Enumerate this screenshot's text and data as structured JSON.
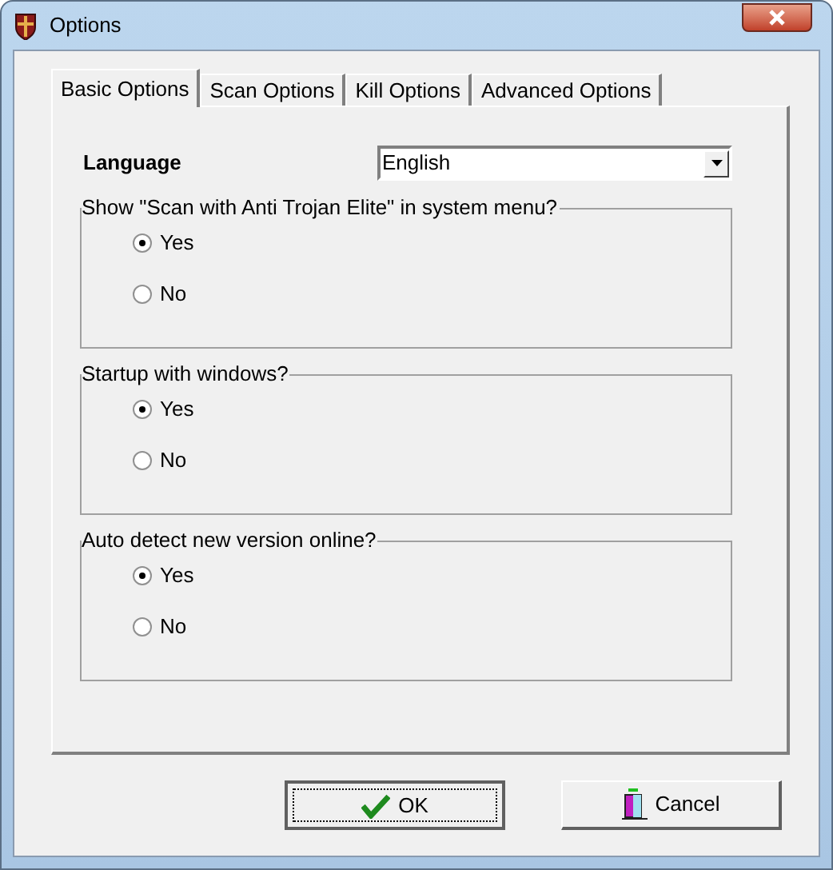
{
  "window": {
    "title": "Options"
  },
  "tabs": [
    {
      "label": "Basic Options",
      "selected": true
    },
    {
      "label": "Scan Options",
      "selected": false
    },
    {
      "label": "Kill Options",
      "selected": false
    },
    {
      "label": "Advanced Options",
      "selected": false
    }
  ],
  "language": {
    "label": "Language",
    "value": "English"
  },
  "groups": [
    {
      "title": "Show \"Scan with Anti Trojan Elite\" in system menu?",
      "options": [
        {
          "label": "Yes",
          "selected": true
        },
        {
          "label": "No",
          "selected": false
        }
      ]
    },
    {
      "title": "Startup with windows?",
      "options": [
        {
          "label": "Yes",
          "selected": true
        },
        {
          "label": "No",
          "selected": false
        }
      ]
    },
    {
      "title": "Auto detect new version online?",
      "options": [
        {
          "label": "Yes",
          "selected": true
        },
        {
          "label": "No",
          "selected": false
        }
      ]
    }
  ],
  "buttons": [
    {
      "label": "OK",
      "kind": "ok"
    },
    {
      "label": "Cancel",
      "kind": "cancel"
    }
  ]
}
